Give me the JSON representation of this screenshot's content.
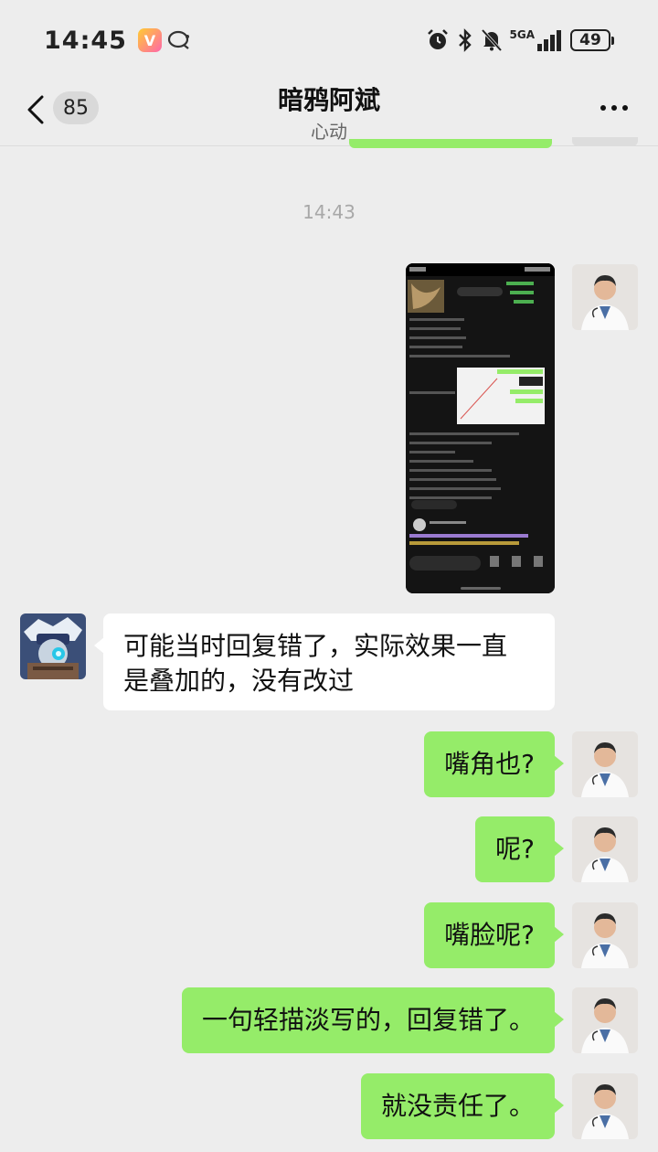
{
  "status_bar": {
    "time": "14:45",
    "network": "5GA",
    "battery": "49",
    "icons": [
      "app-icon",
      "chat-bubble-icon",
      "alarm-icon",
      "bluetooth-icon",
      "mute-icon",
      "signal-icon",
      "battery-icon"
    ]
  },
  "header": {
    "unread_count": "85",
    "title": "暗鸦阿斌",
    "subtitle": "心动"
  },
  "timestamp": "14:43",
  "messages": [
    {
      "from": "self",
      "type": "image"
    },
    {
      "from": "other",
      "text_line1": "可能当时回复错了，实际效果一直",
      "text_line2": "是叠加的，没有改过"
    },
    {
      "from": "self",
      "text": "嘴角也?"
    },
    {
      "from": "self",
      "text": "呢?"
    },
    {
      "from": "self",
      "text": "嘴脸呢?"
    },
    {
      "from": "self",
      "text": "一句轻描淡写的，回复错了。"
    },
    {
      "from": "self",
      "text": "就没责任了。"
    }
  ],
  "colors": {
    "background": "#ededed",
    "self_bubble": "#95ec69",
    "other_bubble": "#ffffff"
  }
}
